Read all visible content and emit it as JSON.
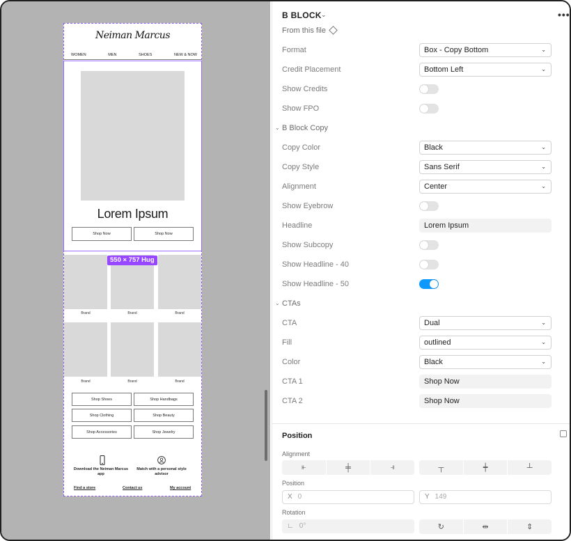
{
  "canvas": {
    "preview": {
      "logo": "Neiman Marcus",
      "nav": [
        "WOMEN",
        "MEN",
        "SHOES",
        "NEW & NOW"
      ],
      "hero_headline": "Lorem Ipsum",
      "hero_cta_1": "Shop Now",
      "hero_cta_2": "Shop Now",
      "size_badge": "550 × 757 Hug",
      "brand_caption": "Brand",
      "categories": [
        "Shop Shoes",
        "Shop Handbags",
        "Shop Clothing",
        "Shop Beauty",
        "Shop Accessories",
        "Shop Jewelry"
      ],
      "footer_app": "Download the Neiman Marcus app",
      "footer_advisor": "Match with a personal style advisor",
      "footer_links": [
        "Find a store",
        "Contact us",
        "My account"
      ]
    }
  },
  "panel": {
    "title": "B BLOCK",
    "source": "From this file",
    "rows": {
      "format": {
        "label": "Format",
        "value": "Box - Copy Bottom"
      },
      "credit_placement": {
        "label": "Credit Placement",
        "value": "Bottom Left"
      },
      "show_credits": {
        "label": "Show Credits",
        "on": false
      },
      "show_fpo": {
        "label": "Show FPO",
        "on": false
      }
    },
    "copy_section": {
      "title": "B Block Copy",
      "copy_color": {
        "label": "Copy Color",
        "value": "Black"
      },
      "copy_style": {
        "label": "Copy Style",
        "value": "Sans Serif"
      },
      "alignment": {
        "label": "Alignment",
        "value": "Center"
      },
      "show_eyebrow": {
        "label": "Show Eyebrow",
        "on": false
      },
      "headline": {
        "label": "Headline",
        "value": "Lorem Ipsum"
      },
      "show_subcopy": {
        "label": "Show Subcopy",
        "on": false
      },
      "show_headline_40": {
        "label": "Show Headline - 40",
        "on": false
      },
      "show_headline_50": {
        "label": "Show Headline - 50",
        "on": true
      }
    },
    "ctas_section": {
      "title": "CTAs",
      "cta": {
        "label": "CTA",
        "value": "Dual"
      },
      "fill": {
        "label": "Fill",
        "value": "outlined"
      },
      "color": {
        "label": "Color",
        "value": "Black"
      },
      "cta1": {
        "label": "CTA 1",
        "value": "Shop Now"
      },
      "cta2": {
        "label": "CTA 2",
        "value": "Shop Now"
      }
    },
    "position": {
      "title": "Position",
      "alignment_label": "Alignment",
      "position_label": "Position",
      "x_label": "X",
      "x_value": "0",
      "y_label": "Y",
      "y_value": "149",
      "rotation_label": "Rotation",
      "rotation_value": "0°"
    }
  },
  "colors": {
    "accent": "#0d99ff",
    "selection": "#9747ff",
    "canvas": "#b3b3b3"
  }
}
